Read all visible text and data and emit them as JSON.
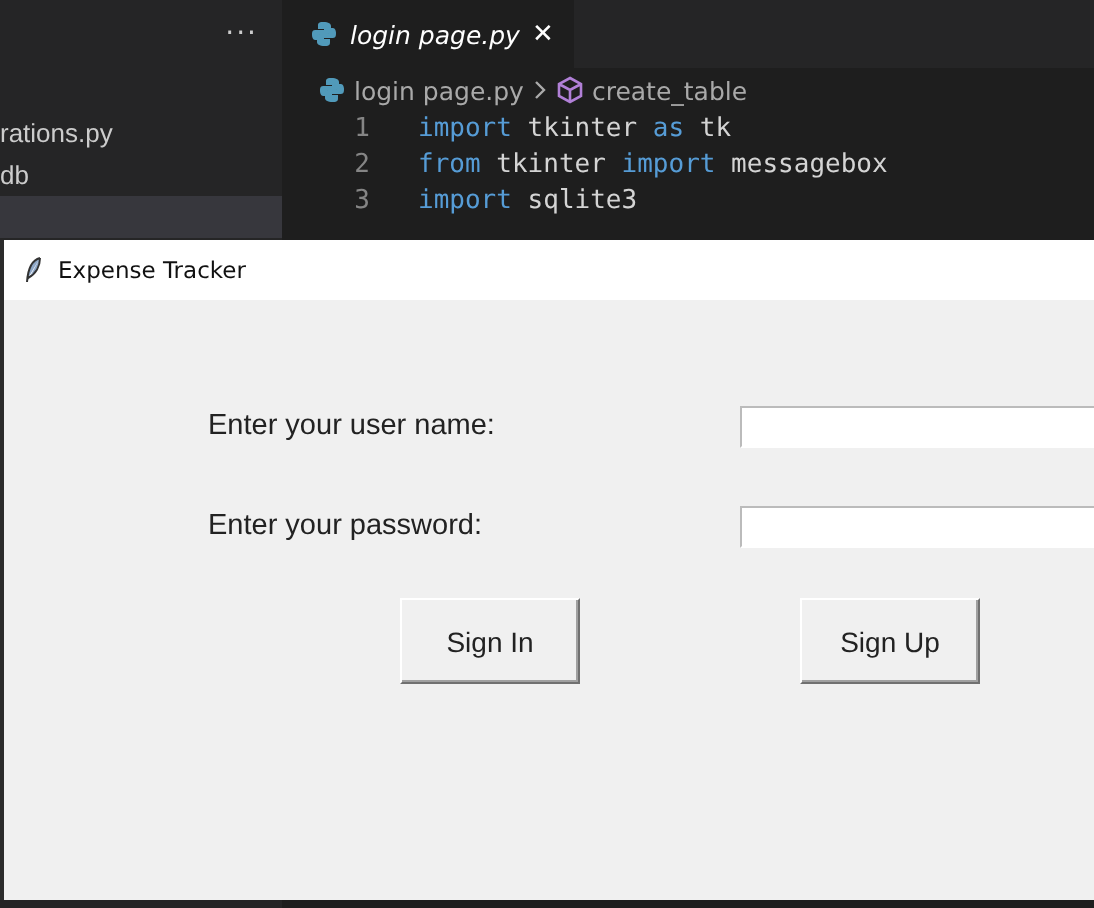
{
  "editor": {
    "more_button": "···",
    "explorer_items": [
      {
        "label": "rations.py",
        "selected": false
      },
      {
        "label": "db",
        "selected": false
      },
      {
        "selected": true
      }
    ],
    "tabs": [
      {
        "label": "login page.py",
        "selected": true,
        "close": "✕"
      }
    ],
    "breadcrumb": [
      "login page.py",
      "create_table"
    ],
    "code_lines": [
      {
        "number": "1",
        "tokens": [
          {
            "text": "import",
            "kind": "keyword"
          },
          {
            "text": " tkinter ",
            "kind": "plain"
          },
          {
            "text": "as",
            "kind": "keyword"
          },
          {
            "text": " tk",
            "kind": "plain"
          }
        ]
      },
      {
        "number": "2",
        "tokens": [
          {
            "text": "from",
            "kind": "keyword"
          },
          {
            "text": " tkinter ",
            "kind": "plain"
          },
          {
            "text": "import",
            "kind": "keyword"
          },
          {
            "text": " messagebox",
            "kind": "plain"
          }
        ]
      },
      {
        "number": "3",
        "tokens": [
          {
            "text": "import",
            "kind": "keyword"
          },
          {
            "text": " sqlite3",
            "kind": "plain"
          }
        ]
      }
    ]
  },
  "dialog": {
    "title": "Expense Tracker",
    "fields": [
      {
        "label": "Enter your user name:"
      },
      {
        "label": "Enter your password:"
      }
    ],
    "buttons": [
      "Sign In",
      "Sign Up"
    ]
  }
}
